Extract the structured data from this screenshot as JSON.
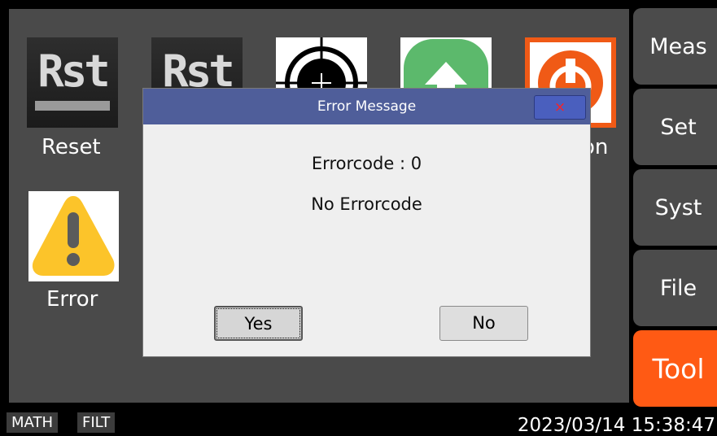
{
  "tiles": {
    "reset": {
      "label": "Reset",
      "icon_text": "Rst"
    },
    "reset2": {
      "icon_text": "Rst"
    },
    "position": {
      "label_fragment": "on"
    },
    "error": {
      "label": "Error"
    }
  },
  "menu": [
    {
      "label": "Meas",
      "active": false
    },
    {
      "label": "Set",
      "active": false
    },
    {
      "label": "Syst",
      "active": false
    },
    {
      "label": "File",
      "active": false
    },
    {
      "label": "Tool",
      "active": true
    }
  ],
  "status": {
    "badges": [
      "MATH",
      "FILT"
    ],
    "datetime": "2023/03/14 15:38:47"
  },
  "dialog": {
    "title": "Error Message",
    "close_glyph": "×",
    "line1": "Errorcode : 0",
    "line2": "No Errorcode",
    "yes_label": "Yes",
    "no_label": "No"
  },
  "colors": {
    "accent": "#ff5a14",
    "dialog_title": "#4f5e9a",
    "panel": "#4a4a4a"
  }
}
